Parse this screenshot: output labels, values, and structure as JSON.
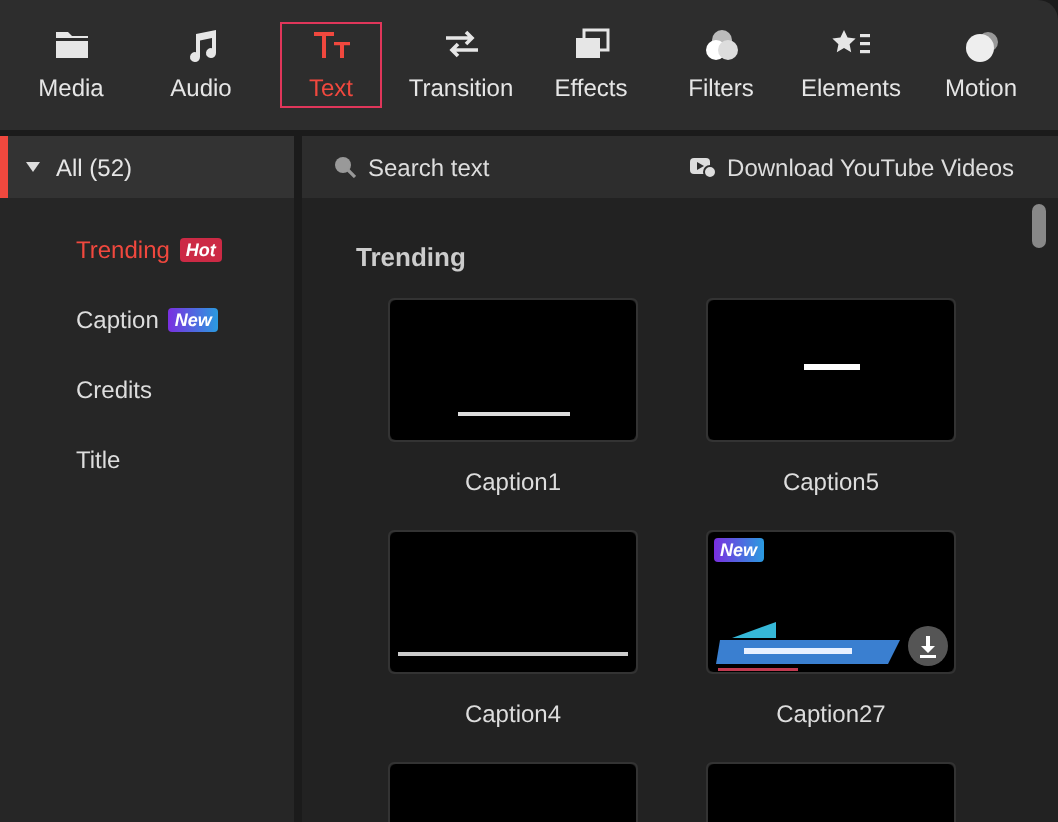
{
  "toolbar": {
    "tabs": [
      {
        "label": "Media",
        "selected": false
      },
      {
        "label": "Audio",
        "selected": false
      },
      {
        "label": "Text",
        "selected": true
      },
      {
        "label": "Transition",
        "selected": false
      },
      {
        "label": "Effects",
        "selected": false
      },
      {
        "label": "Filters",
        "selected": false
      },
      {
        "label": "Elements",
        "selected": false
      },
      {
        "label": "Motion",
        "selected": false
      }
    ]
  },
  "sidebar": {
    "header": {
      "label": "All (52)",
      "expanded": true
    },
    "items": [
      {
        "label": "Trending",
        "selected": true,
        "badge": {
          "text": "Hot",
          "kind": "hot"
        }
      },
      {
        "label": "Caption",
        "selected": false,
        "badge": {
          "text": "New",
          "kind": "new"
        }
      },
      {
        "label": "Credits",
        "selected": false
      },
      {
        "label": "Title",
        "selected": false
      }
    ]
  },
  "content": {
    "search": {
      "placeholder": "Search text"
    },
    "download_link": "Download YouTube Videos",
    "section_title": "Trending",
    "template_rows": [
      {
        "templates": [
          {
            "label": "Caption1",
            "kind": "picture"
          },
          {
            "label": "Caption5",
            "kind": "picture"
          }
        ]
      },
      {
        "templates": [
          {
            "label": "Caption4",
            "kind": "picture"
          },
          {
            "label": "Caption27",
            "kind": "picture",
            "badge": "New",
            "downloadable": true
          }
        ]
      },
      {
        "templates": [
          {
            "kind": "picture"
          },
          {
            "kind": "picture"
          }
        ]
      }
    ]
  }
}
